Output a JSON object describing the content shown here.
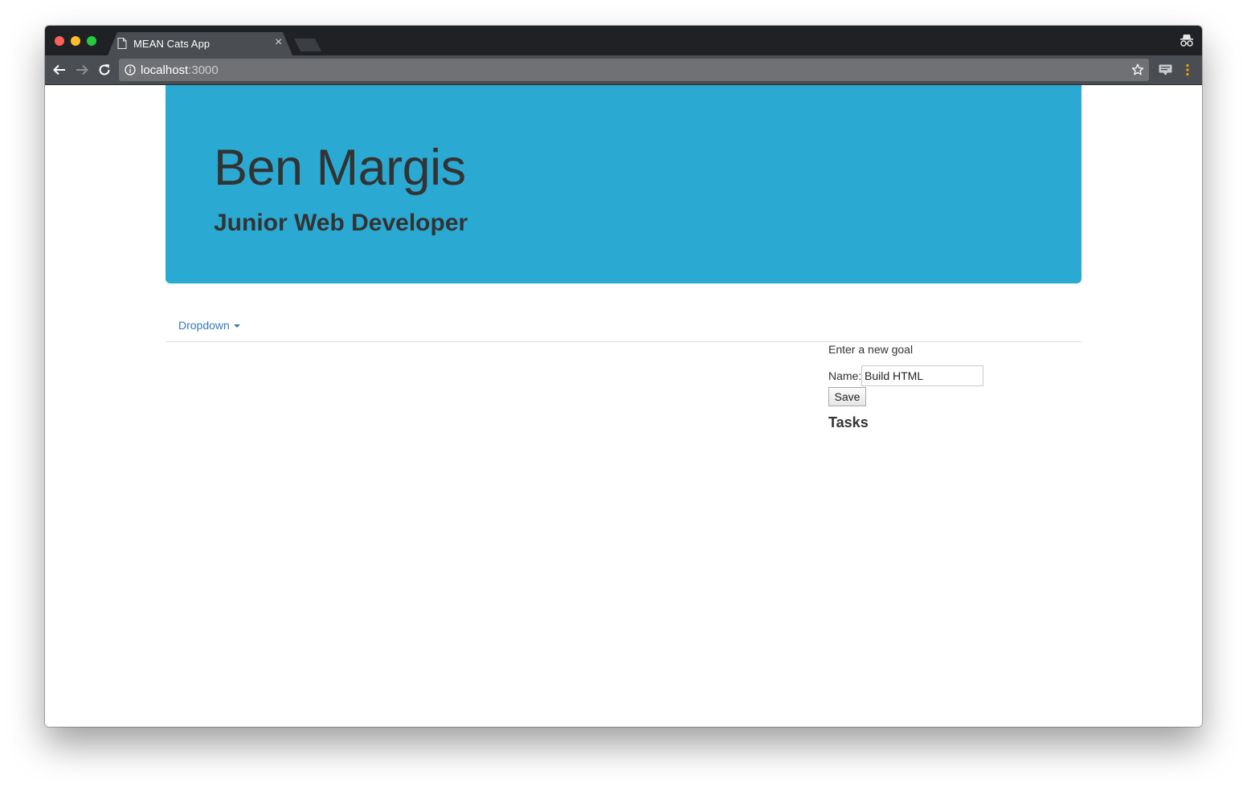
{
  "browser": {
    "tab_title": "MEAN Cats App",
    "tab_close": "×",
    "url_host": "localhost",
    "url_port": ":3000",
    "icons": {
      "page": "page-icon",
      "back": "back-arrow-icon",
      "forward": "forward-arrow-icon",
      "reload": "reload-icon",
      "info": "info-icon",
      "star": "star-icon",
      "extension": "extension-icon",
      "menu": "kebab-menu-icon",
      "incognito": "incognito-icon"
    },
    "colors": {
      "tabstrip": "#1f2124",
      "toolbar": "#4a4d51",
      "omnibox": "#6f7174"
    }
  },
  "page": {
    "jumbotron": {
      "title": "Ben Margis",
      "subtitle": "Junior Web Developer",
      "background": "#2aa9d3"
    },
    "navbar": {
      "dropdown_label": "Dropdown"
    },
    "goal_form": {
      "heading": "Enter a new goal",
      "name_label": "Name:",
      "name_value": "Build HTML",
      "save_label": "Save"
    },
    "tasks": {
      "heading": "Tasks"
    }
  }
}
